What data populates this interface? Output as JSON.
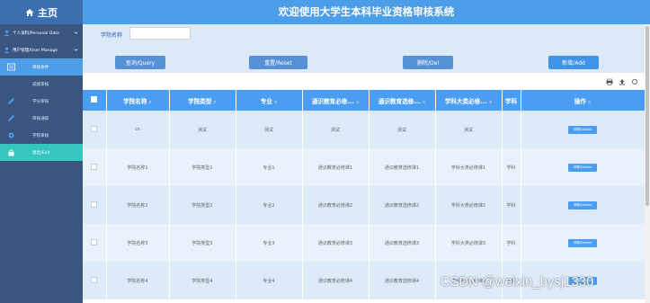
{
  "header": {
    "home_label": "主页",
    "system_title": "欢迎使用大学生本科毕业资格审核系统"
  },
  "sidebar": {
    "items": [
      {
        "label": "个人资料/Personal Data",
        "type": "group"
      },
      {
        "label": "用户管理/User Manage",
        "type": "group"
      },
      {
        "label": "审核条件",
        "type": "sub",
        "state": "active"
      },
      {
        "label": "成绩审核",
        "type": "sub"
      },
      {
        "label": "学分审核",
        "type": "sub"
      },
      {
        "label": "审核通知",
        "type": "sub"
      },
      {
        "label": "学院审核",
        "type": "sub"
      },
      {
        "label": "退出/Exit",
        "type": "sub",
        "state": "green"
      }
    ]
  },
  "search": {
    "label": "学院名称",
    "value": "",
    "placeholder": ""
  },
  "buttons": {
    "query": "查询/Query",
    "reset": "重置/Reset",
    "delete": "删除/Del",
    "add": "新增/Add"
  },
  "table": {
    "columns": [
      "学院名称",
      "学院类型",
      "专业",
      "通识教育必修...",
      "通识教育选修...",
      "学科大类必修...",
      "学科",
      "操作"
    ],
    "rows": [
      [
        "cs",
        "测试",
        "测试",
        "测试",
        "测试",
        "测试",
        ""
      ],
      [
        "学院名称1",
        "学院类型1",
        "专业1",
        "通识教育必修课1",
        "通识教育选修课1",
        "学科大类必修课1",
        "学科"
      ],
      [
        "学院名称2",
        "学院类型2",
        "专业2",
        "通识教育必修课2",
        "通识教育选修课2",
        "学科大类必修课2",
        "学科"
      ],
      [
        "学院名称3",
        "学院类型3",
        "专业3",
        "通识教育必修课3",
        "通识教育选修课3",
        "学科大类必修课3",
        "学科"
      ],
      [
        "学院名称4",
        "学院类型4",
        "专业4",
        "通识教育必修课4",
        "通识教育选修课4",
        "学科大类必修课4",
        "学科"
      ]
    ],
    "detail_label": "详情/Details"
  },
  "watermark": "CSDN @weixin_bysj1330",
  "colors": {
    "header": "#4d9ee8",
    "sidebar": "#3a5680",
    "accent": "#4a9df0",
    "exit": "#35c6bf"
  }
}
